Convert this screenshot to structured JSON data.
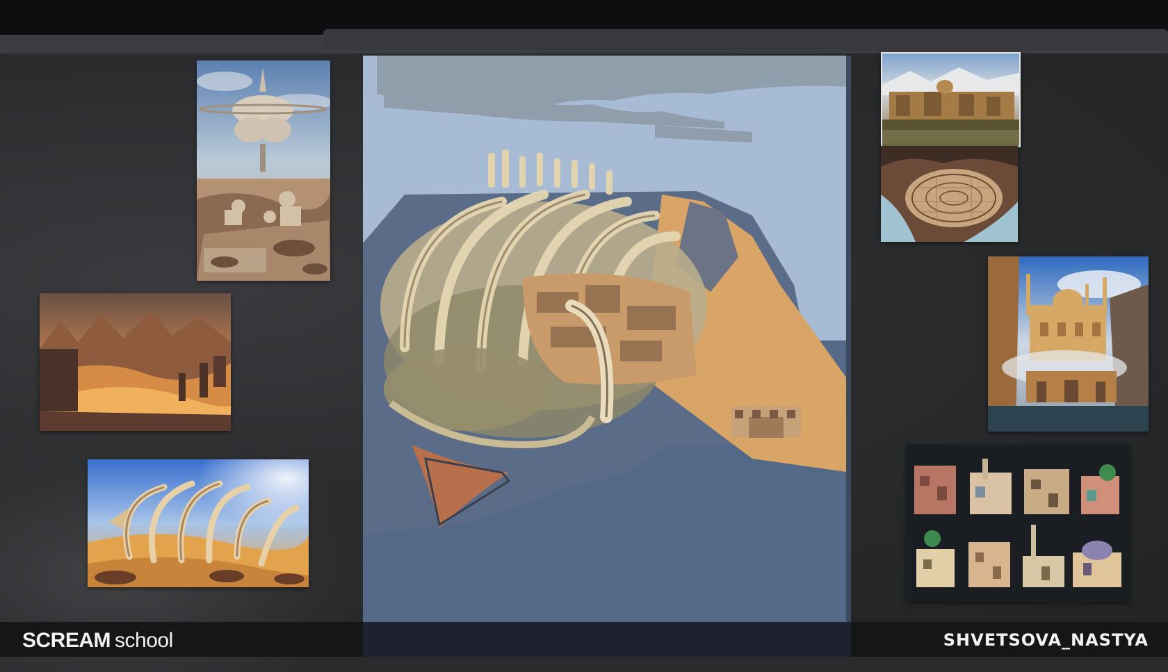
{
  "footer": {
    "brand_bold": "SCREAM",
    "brand_light": "school",
    "author": "SHVETSOVA_NASTYA"
  },
  "references": [
    {
      "name": "floating-palace-reference",
      "subject": "floating palace above desert ruins"
    },
    {
      "name": "desert-canyon-reference",
      "subject": "glowing desert canyon"
    },
    {
      "name": "skeleton-desert-reference",
      "subject": "giant skeleton in the sand"
    },
    {
      "name": "walled-city-reference",
      "subject": "walled city by the river"
    },
    {
      "name": "city-map-reference",
      "subject": "city map"
    },
    {
      "name": "palace-gorge-reference",
      "subject": "palace in a gorge"
    },
    {
      "name": "buildings-sheet-reference",
      "subject": "eastern buildings sheet"
    }
  ],
  "colors": {
    "sky": "#a8bbd5",
    "ground": "#546887",
    "sand": "#d9a566",
    "bone": "#d9c79e",
    "board": "#2a2b2d"
  }
}
